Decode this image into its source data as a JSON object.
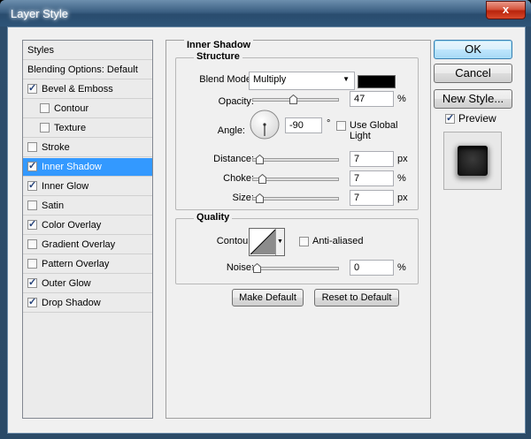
{
  "window": {
    "title": "Layer Style",
    "close_label": "x"
  },
  "styles_list": {
    "header": "Styles",
    "blending_options": "Blending Options: Default",
    "items": [
      {
        "label": "Bevel & Emboss",
        "checked": true,
        "indent": false,
        "selected": false
      },
      {
        "label": "Contour",
        "checked": false,
        "indent": true,
        "selected": false
      },
      {
        "label": "Texture",
        "checked": false,
        "indent": true,
        "selected": false
      },
      {
        "label": "Stroke",
        "checked": false,
        "indent": false,
        "selected": false
      },
      {
        "label": "Inner Shadow",
        "checked": true,
        "indent": false,
        "selected": true
      },
      {
        "label": "Inner Glow",
        "checked": true,
        "indent": false,
        "selected": false
      },
      {
        "label": "Satin",
        "checked": false,
        "indent": false,
        "selected": false
      },
      {
        "label": "Color Overlay",
        "checked": true,
        "indent": false,
        "selected": false
      },
      {
        "label": "Gradient Overlay",
        "checked": false,
        "indent": false,
        "selected": false
      },
      {
        "label": "Pattern Overlay",
        "checked": false,
        "indent": false,
        "selected": false
      },
      {
        "label": "Outer Glow",
        "checked": true,
        "indent": false,
        "selected": false
      },
      {
        "label": "Drop Shadow",
        "checked": true,
        "indent": false,
        "selected": false
      }
    ]
  },
  "panel": {
    "title": "Inner Shadow",
    "structure": {
      "title": "Structure",
      "blend_mode_label": "Blend Mode:",
      "blend_mode_value": "Multiply",
      "shadow_color": "#000000",
      "opacity_label": "Opacity:",
      "opacity_value": "47",
      "opacity_unit": "%",
      "opacity_level": 0.47,
      "angle_label": "Angle:",
      "angle_value": "-90",
      "angle_unit": "°",
      "angle_degrees": -90,
      "use_global_light_label": "Use Global Light",
      "use_global_light": false,
      "distance_label": "Distance:",
      "distance_value": "7",
      "distance_unit": "px",
      "distance_level": 0.03,
      "choke_label": "Choke:",
      "choke_value": "7",
      "choke_unit": "%",
      "choke_level": 0.07,
      "size_label": "Size:",
      "size_value": "7",
      "size_unit": "px",
      "size_level": 0.03
    },
    "quality": {
      "title": "Quality",
      "contour_label": "Contour:",
      "anti_aliased_label": "Anti-aliased",
      "anti_aliased": false,
      "noise_label": "Noise:",
      "noise_value": "0",
      "noise_unit": "%",
      "noise_level": 0
    },
    "make_default_label": "Make Default",
    "reset_default_label": "Reset to Default"
  },
  "actions": {
    "ok_label": "OK",
    "cancel_label": "Cancel",
    "new_style_label": "New Style...",
    "preview_label": "Preview",
    "preview_checked": true
  }
}
